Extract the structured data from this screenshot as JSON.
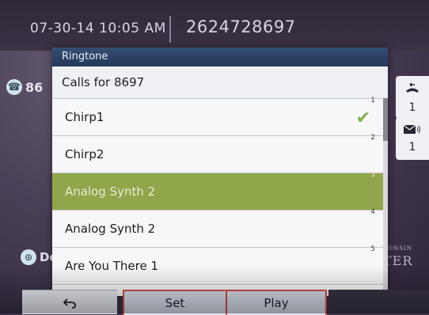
{
  "header": {
    "datetime": "07-30-14 10:05 AM",
    "extension": "2624728697"
  },
  "background": {
    "line_key_label": "86",
    "do_key_label": "Do",
    "brand_small": "CONSIN",
    "brand_big": "TER"
  },
  "side_keys": {
    "calls_count": "1",
    "voicemail_count": "1",
    "calls_icon": "phone-arrow-icon",
    "voicemail_icon": "envelope-icon"
  },
  "dialog": {
    "title": "Ringtone",
    "subtitle": "Calls for 8697",
    "items": [
      {
        "label": "Chirp1",
        "num": "1",
        "checked": true
      },
      {
        "label": "Chirp2",
        "num": "2",
        "checked": false
      },
      {
        "label": "Analog Synth 2",
        "num": "3",
        "checked": false
      },
      {
        "label": "Analog Synth 2",
        "num": "4",
        "checked": false
      },
      {
        "label": "Are You There 1",
        "num": "5",
        "checked": false
      }
    ],
    "selected_index": 2
  },
  "softkeys": {
    "back_icon": "back-arrow-icon",
    "set_label": "Set",
    "play_label": "Play"
  },
  "colors": {
    "selected_row": "#8fa74a",
    "title_bar": "#2a3f62",
    "softkey_highlight": "#d94b4b"
  }
}
